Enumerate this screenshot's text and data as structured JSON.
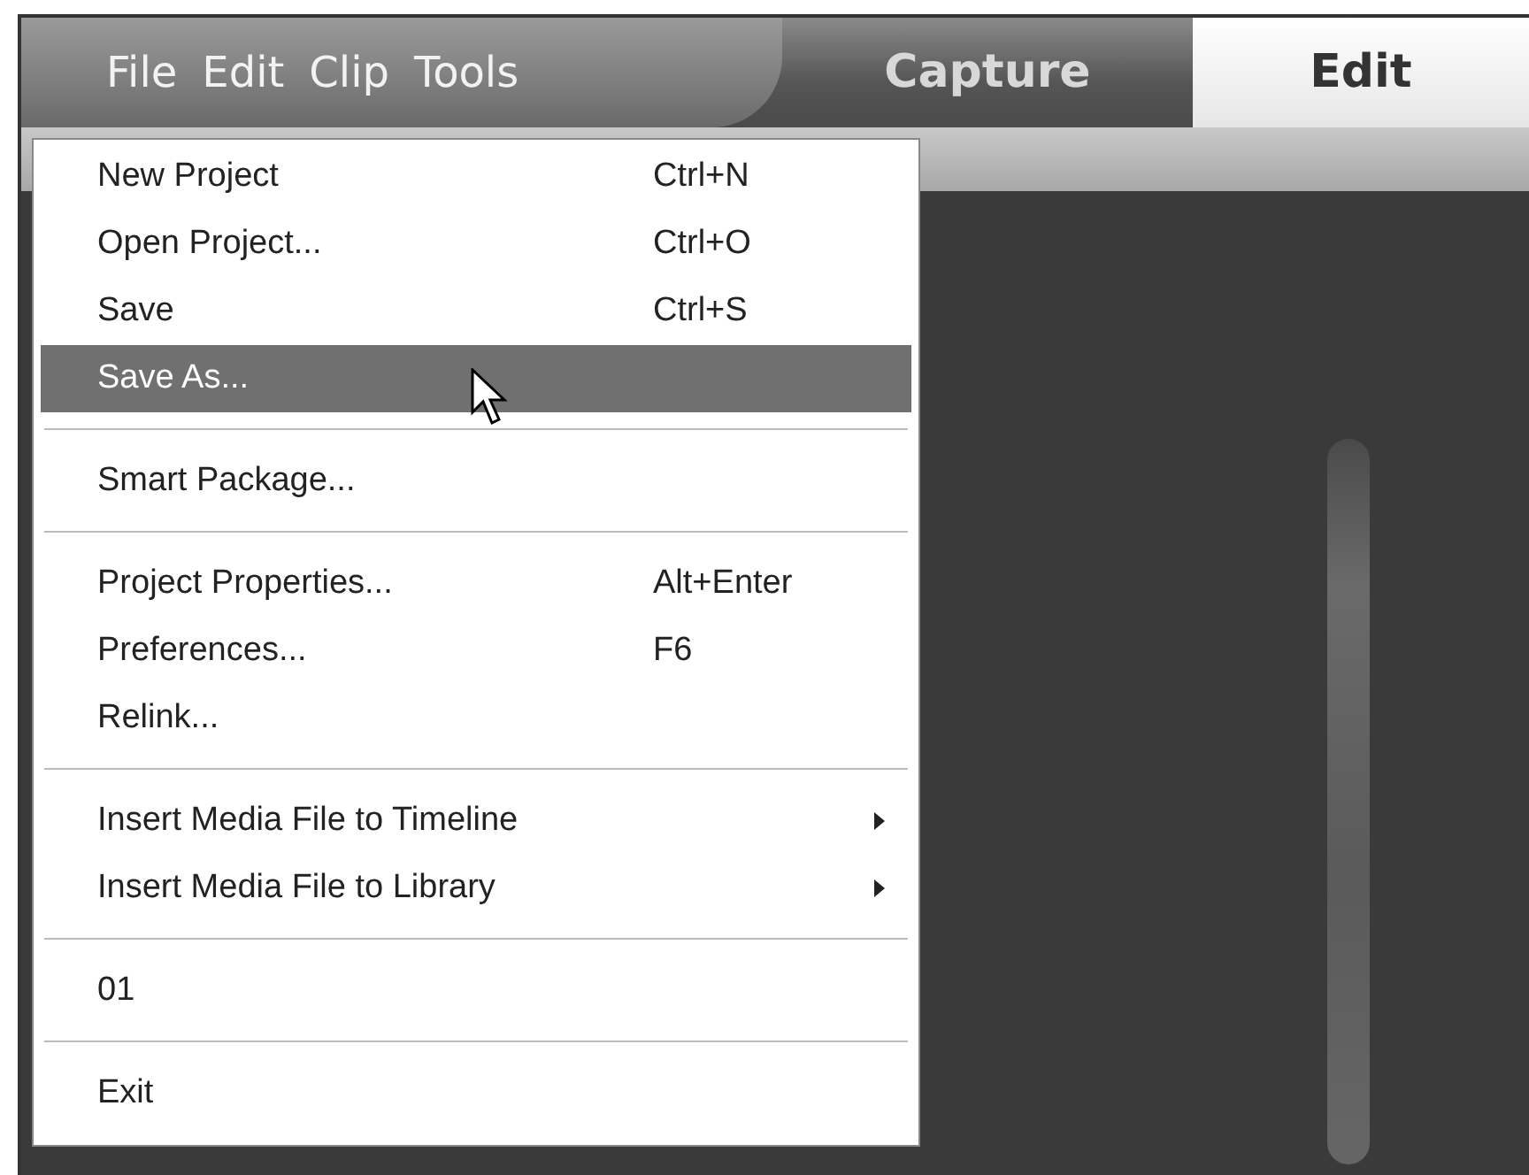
{
  "menubar": {
    "items": [
      {
        "label": "File"
      },
      {
        "label": "Edit"
      },
      {
        "label": "Clip"
      },
      {
        "label": "Tools"
      }
    ]
  },
  "mode_tabs": [
    {
      "label": "Capture",
      "selected": false
    },
    {
      "label": "Edit",
      "selected": true
    }
  ],
  "file_menu": {
    "items": [
      {
        "kind": "item",
        "label": "New Project",
        "shortcut": "Ctrl+N",
        "submenu": false,
        "selected": false
      },
      {
        "kind": "item",
        "label": "Open Project...",
        "shortcut": "Ctrl+O",
        "submenu": false,
        "selected": false
      },
      {
        "kind": "item",
        "label": "Save",
        "shortcut": "Ctrl+S",
        "submenu": false,
        "selected": false
      },
      {
        "kind": "item",
        "label": "Save As...",
        "submenu": false,
        "selected": true
      },
      {
        "kind": "separator"
      },
      {
        "kind": "item",
        "label": "Smart Package...",
        "submenu": false,
        "selected": false
      },
      {
        "kind": "separator"
      },
      {
        "kind": "item",
        "label": "Project Properties...",
        "shortcut": "Alt+Enter",
        "submenu": false,
        "selected": false
      },
      {
        "kind": "item",
        "label": "Preferences...",
        "shortcut": "F6",
        "submenu": false,
        "selected": false
      },
      {
        "kind": "item",
        "label": "Relink...",
        "submenu": false,
        "selected": false
      },
      {
        "kind": "separator"
      },
      {
        "kind": "item",
        "label": "Insert Media File to Timeline",
        "submenu": true,
        "selected": false
      },
      {
        "kind": "item",
        "label": "Insert Media File to Library",
        "submenu": true,
        "selected": false
      },
      {
        "kind": "separator"
      },
      {
        "kind": "item",
        "label": "01",
        "submenu": false,
        "selected": false
      },
      {
        "kind": "separator"
      },
      {
        "kind": "item",
        "label": "Exit",
        "submenu": false,
        "selected": false
      }
    ]
  }
}
